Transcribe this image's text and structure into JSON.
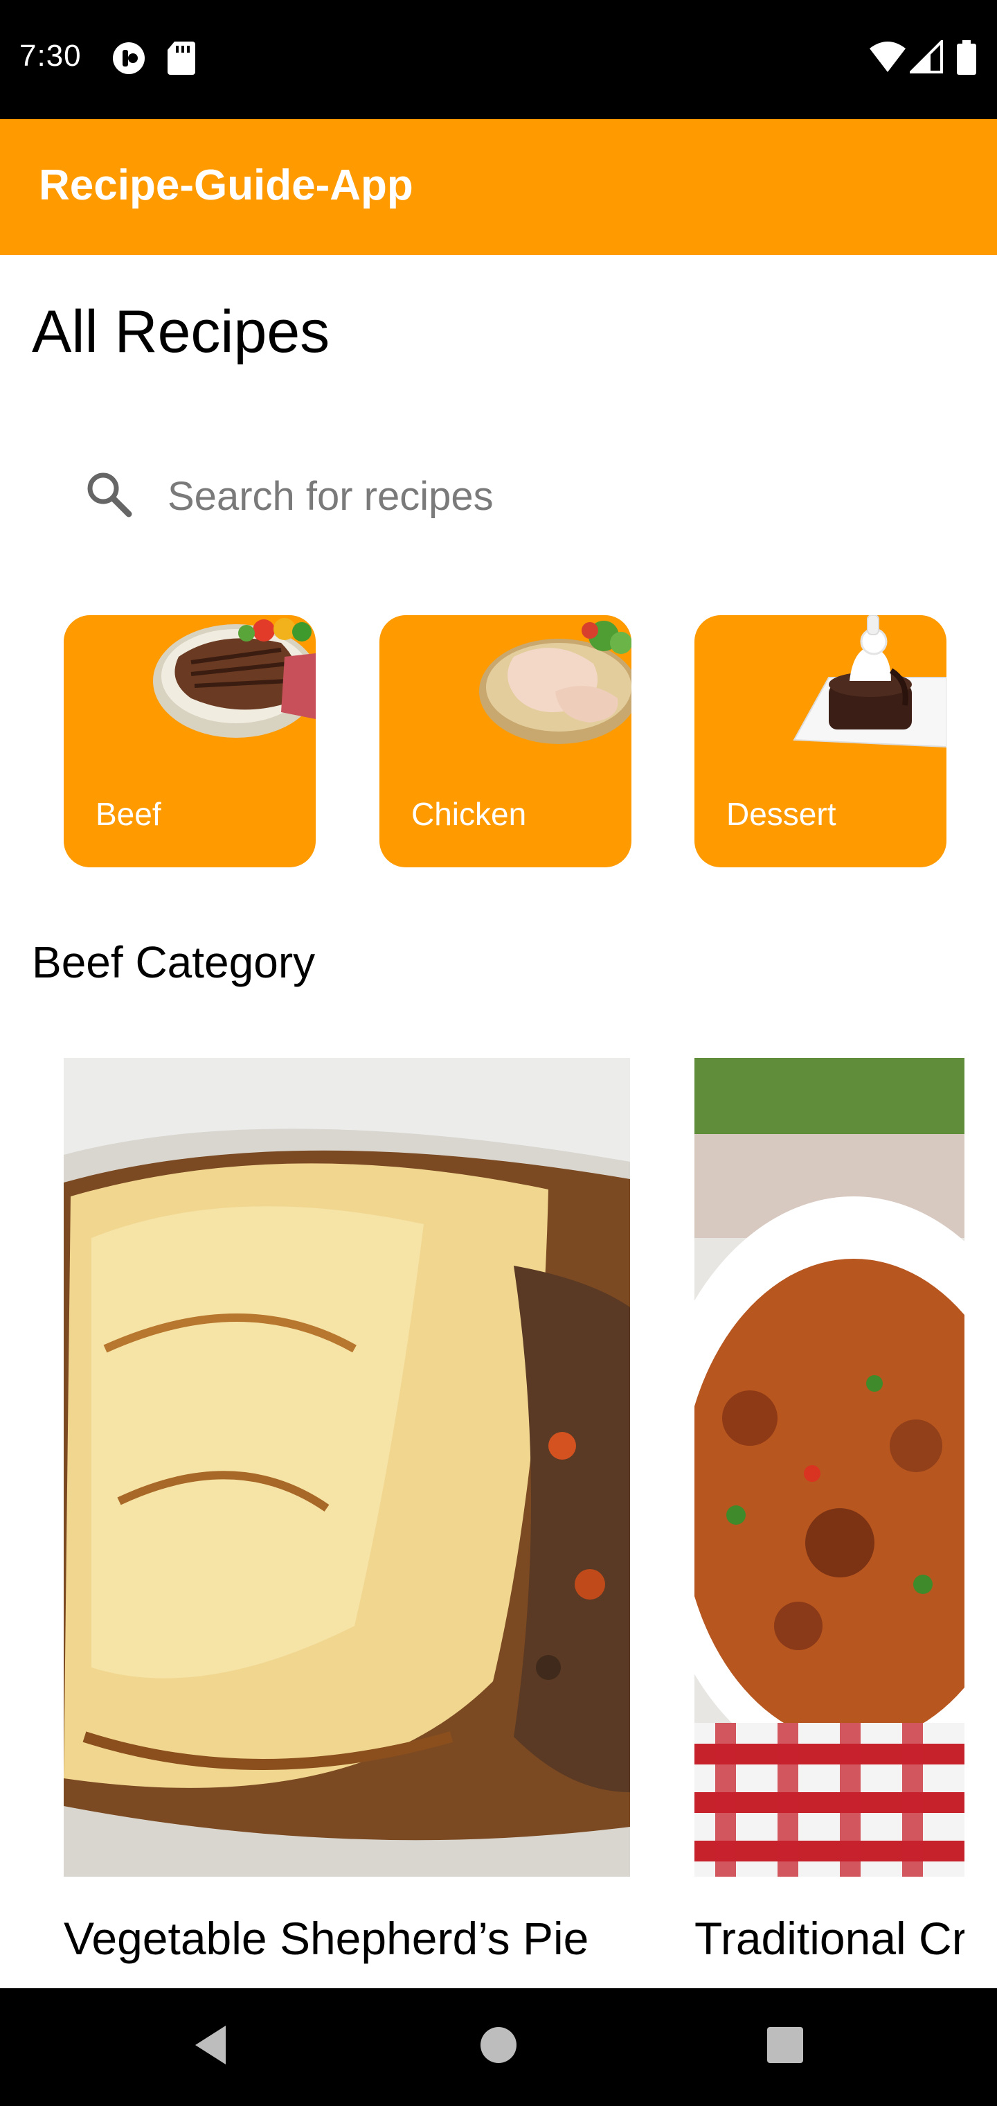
{
  "status_bar": {
    "time": "7:30"
  },
  "app_bar": {
    "title": "Recipe-Guide-App"
  },
  "page": {
    "heading": "All Recipes"
  },
  "search": {
    "placeholder": "Search for recipes",
    "value": ""
  },
  "categories": [
    {
      "label": "Beef"
    },
    {
      "label": "Chicken"
    },
    {
      "label": "Dessert"
    }
  ],
  "section": {
    "title": "Beef Category"
  },
  "recipes": [
    {
      "name": "Vegetable Shepherd’s Pie"
    },
    {
      "name": "Traditional Cr"
    }
  ],
  "colors": {
    "accent": "#FF9B00",
    "bars": "#000000"
  }
}
